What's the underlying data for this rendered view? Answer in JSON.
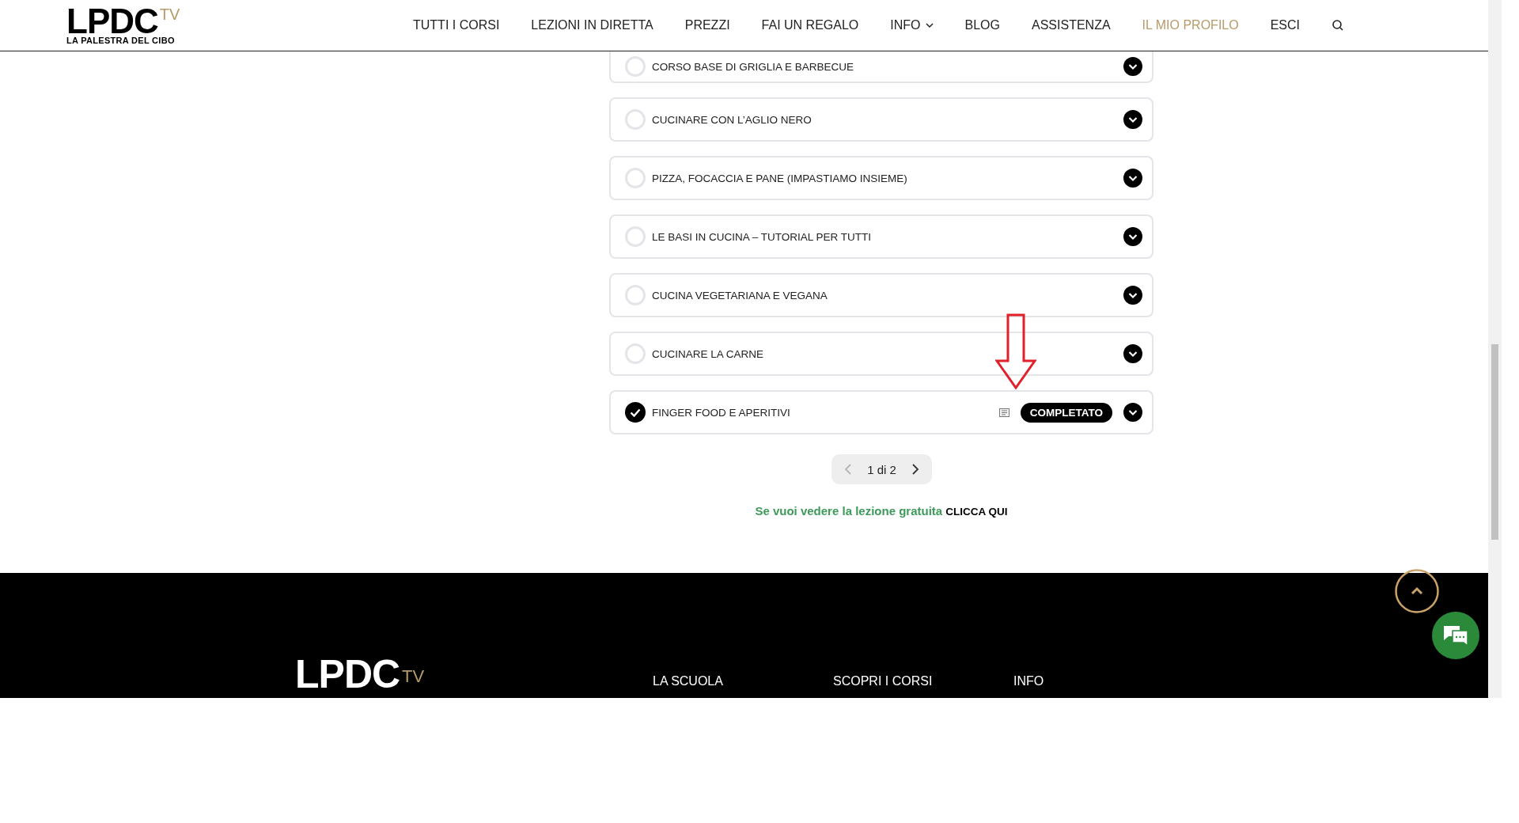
{
  "header": {
    "logo": {
      "main": "LPDC",
      "suffix": "TV",
      "tagline": "LA PALESTRA DEL CIBO"
    },
    "nav": [
      {
        "label": "TUTTI I CORSI",
        "active": false,
        "dropdown": false
      },
      {
        "label": "LEZIONI IN DIRETTA",
        "active": false,
        "dropdown": false
      },
      {
        "label": "PREZZI",
        "active": false,
        "dropdown": false
      },
      {
        "label": "FAI UN REGALO",
        "active": false,
        "dropdown": false
      },
      {
        "label": "INFO",
        "active": false,
        "dropdown": true
      },
      {
        "label": "BLOG",
        "active": false,
        "dropdown": false
      },
      {
        "label": "ASSISTENZA",
        "active": false,
        "dropdown": false
      },
      {
        "label": "IL MIO PROFILO",
        "active": true,
        "dropdown": false
      },
      {
        "label": "ESCI",
        "active": false,
        "dropdown": false
      }
    ]
  },
  "lessons": [
    {
      "title": "CORSO BASE DI GRIGLIA E BARBECUE",
      "completed": false
    },
    {
      "title": "CUCINARE CON L’AGLIO NERO",
      "completed": false
    },
    {
      "title": "PIZZA, FOCACCIA E PANE (IMPASTIAMO INSIEME)",
      "completed": false
    },
    {
      "title": "LE BASI IN CUCINA – TUTORIAL PER TUTTI",
      "completed": false
    },
    {
      "title": "CUCINA VEGETARIANA E VEGANA",
      "completed": false
    },
    {
      "title": "CUCINARE LA CARNE",
      "completed": false
    },
    {
      "title": "FINGER FOOD E APERITIVI",
      "completed": true,
      "badge": "COMPLETATO"
    }
  ],
  "pagination": {
    "label": "1 di 2",
    "prev_disabled": true,
    "next_disabled": false
  },
  "free_lesson": {
    "text": "Se vuoi vedere la lezione gratuita",
    "link": "CLICCA QUI"
  },
  "footer": {
    "logo": {
      "main": "LPDC",
      "suffix": "TV"
    },
    "columns": [
      "LA SCUOLA",
      "SCOPRI I CORSI",
      "INFO"
    ]
  }
}
